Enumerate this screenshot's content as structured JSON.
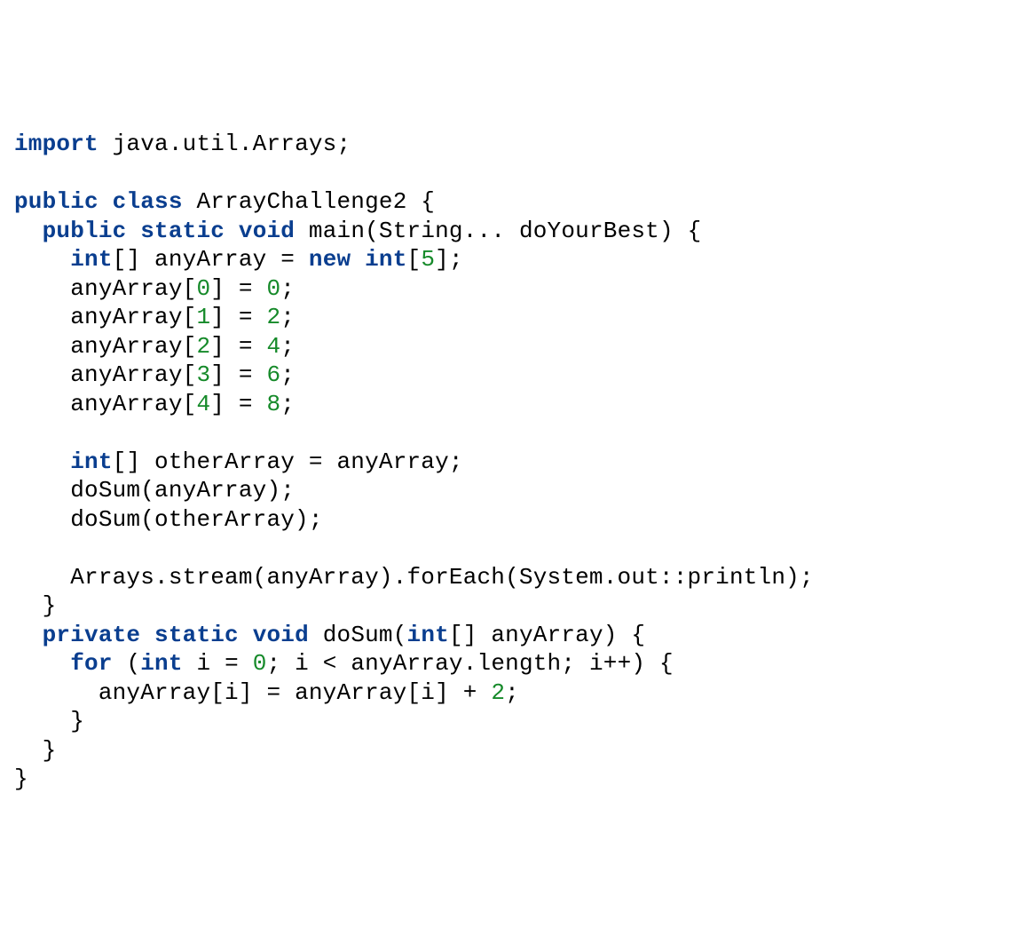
{
  "code": {
    "l1": {
      "kw1": "import",
      "t1": " java.util.Arrays;"
    },
    "l3": {
      "kw1": "public",
      "kw2": "class",
      "t1": " ArrayChallenge2 {"
    },
    "l4": {
      "kw1": "public",
      "kw2": "static",
      "kw3": "void",
      "t1": " main(String... doYourBest) {"
    },
    "l5": {
      "kw1": "int",
      "t1": "[] anyArray = ",
      "kw2": "new",
      "kw3": "int",
      "ob": "[",
      "n1": "5",
      "cb": "];"
    },
    "l6": {
      "t1": "anyArray[",
      "n1": "0",
      "t2": "] = ",
      "n2": "0",
      "t3": ";"
    },
    "l7": {
      "t1": "anyArray[",
      "n1": "1",
      "t2": "] = ",
      "n2": "2",
      "t3": ";"
    },
    "l8": {
      "t1": "anyArray[",
      "n1": "2",
      "t2": "] = ",
      "n2": "4",
      "t3": ";"
    },
    "l9": {
      "t1": "anyArray[",
      "n1": "3",
      "t2": "] = ",
      "n2": "6",
      "t3": ";"
    },
    "l10": {
      "t1": "anyArray[",
      "n1": "4",
      "t2": "] = ",
      "n2": "8",
      "t3": ";"
    },
    "l12": {
      "kw1": "int",
      "t1": "[] otherArray = anyArray;"
    },
    "l13": {
      "t1": "doSum(anyArray);"
    },
    "l14": {
      "t1": "doSum(otherArray);"
    },
    "l16": {
      "t1": "Arrays.stream(anyArray).forEach(System.out::println);"
    },
    "l17": {
      "t1": "}"
    },
    "l18": {
      "kw1": "private",
      "kw2": "static",
      "kw3": "void",
      "t1": " doSum(",
      "kw4": "int",
      "t2": "[] anyArray) {"
    },
    "l19": {
      "kw1": "for",
      "t1": " (",
      "kw2": "int",
      "t2": " i = ",
      "n1": "0",
      "t3": "; i < anyArray.length; i++) {"
    },
    "l20": {
      "t1": "anyArray[i] = anyArray[i] + ",
      "n1": "2",
      "t2": ";"
    },
    "l21": {
      "t1": "}"
    },
    "l22": {
      "t1": "}"
    },
    "l23": {
      "t1": "}"
    }
  }
}
